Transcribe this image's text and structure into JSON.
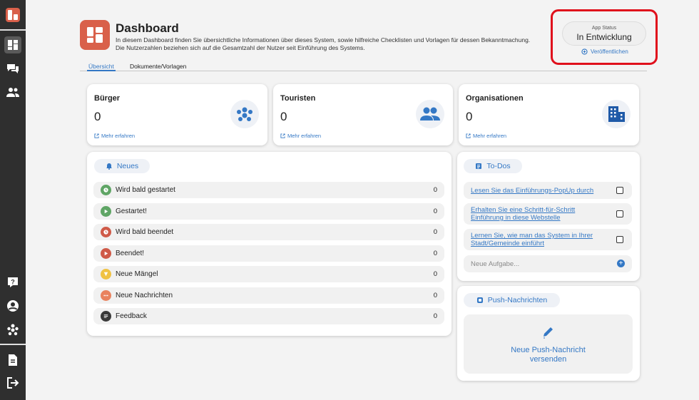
{
  "header": {
    "title": "Dashboard",
    "description": "In diesem Dashboard finden Sie übersichtliche Informationen über dieses System, sowie hilfreiche Checklisten und Vorlagen für dessen Bekanntmachung. Die Nutzerzahlen beziehen sich auf die Gesamtzahl der Nutzer seit Einführung des Systems."
  },
  "tabs": [
    {
      "label": "Übersicht"
    },
    {
      "label": "Dokumente/Vorlagen"
    }
  ],
  "status": {
    "label": "App Status",
    "value": "In Entwicklung",
    "publish_label": "Veröffentlichen"
  },
  "stats": [
    {
      "title": "Bürger",
      "value": "0",
      "link": "Mehr erfahren"
    },
    {
      "title": "Touristen",
      "value": "0",
      "link": "Mehr erfahren"
    },
    {
      "title": "Organisationen",
      "value": "0",
      "link": "Mehr erfahren"
    }
  ],
  "news": {
    "title": "Neues",
    "items": [
      {
        "label": "Wird bald gestartet",
        "count": "0"
      },
      {
        "label": "Gestartet!",
        "count": "0"
      },
      {
        "label": "Wird bald beendet",
        "count": "0"
      },
      {
        "label": "Beendet!",
        "count": "0"
      },
      {
        "label": "Neue Mängel",
        "count": "0"
      },
      {
        "label": "Neue Nachrichten",
        "count": "0"
      },
      {
        "label": "Feedback",
        "count": "0"
      }
    ]
  },
  "todos": {
    "title": "To-Dos",
    "items": [
      {
        "label": "Lesen Sie das Einführungs-PopUp durch"
      },
      {
        "label": "Erhalten Sie eine Schritt-für-Schritt Einführung in diese Webstelle"
      },
      {
        "label": "Lernen Sie, wie man das System in Ihrer Stadt/Gemeinde einführt"
      }
    ],
    "new_task_placeholder": "Neue Aufgabe..."
  },
  "push": {
    "title": "Push-Nachrichten",
    "action": "Neue Push-Nachricht versenden"
  },
  "colors": {
    "accent": "#3478c5",
    "highlight": "#e0101c",
    "brand": "#d9604a",
    "sidebar": "#2f2f2f"
  }
}
